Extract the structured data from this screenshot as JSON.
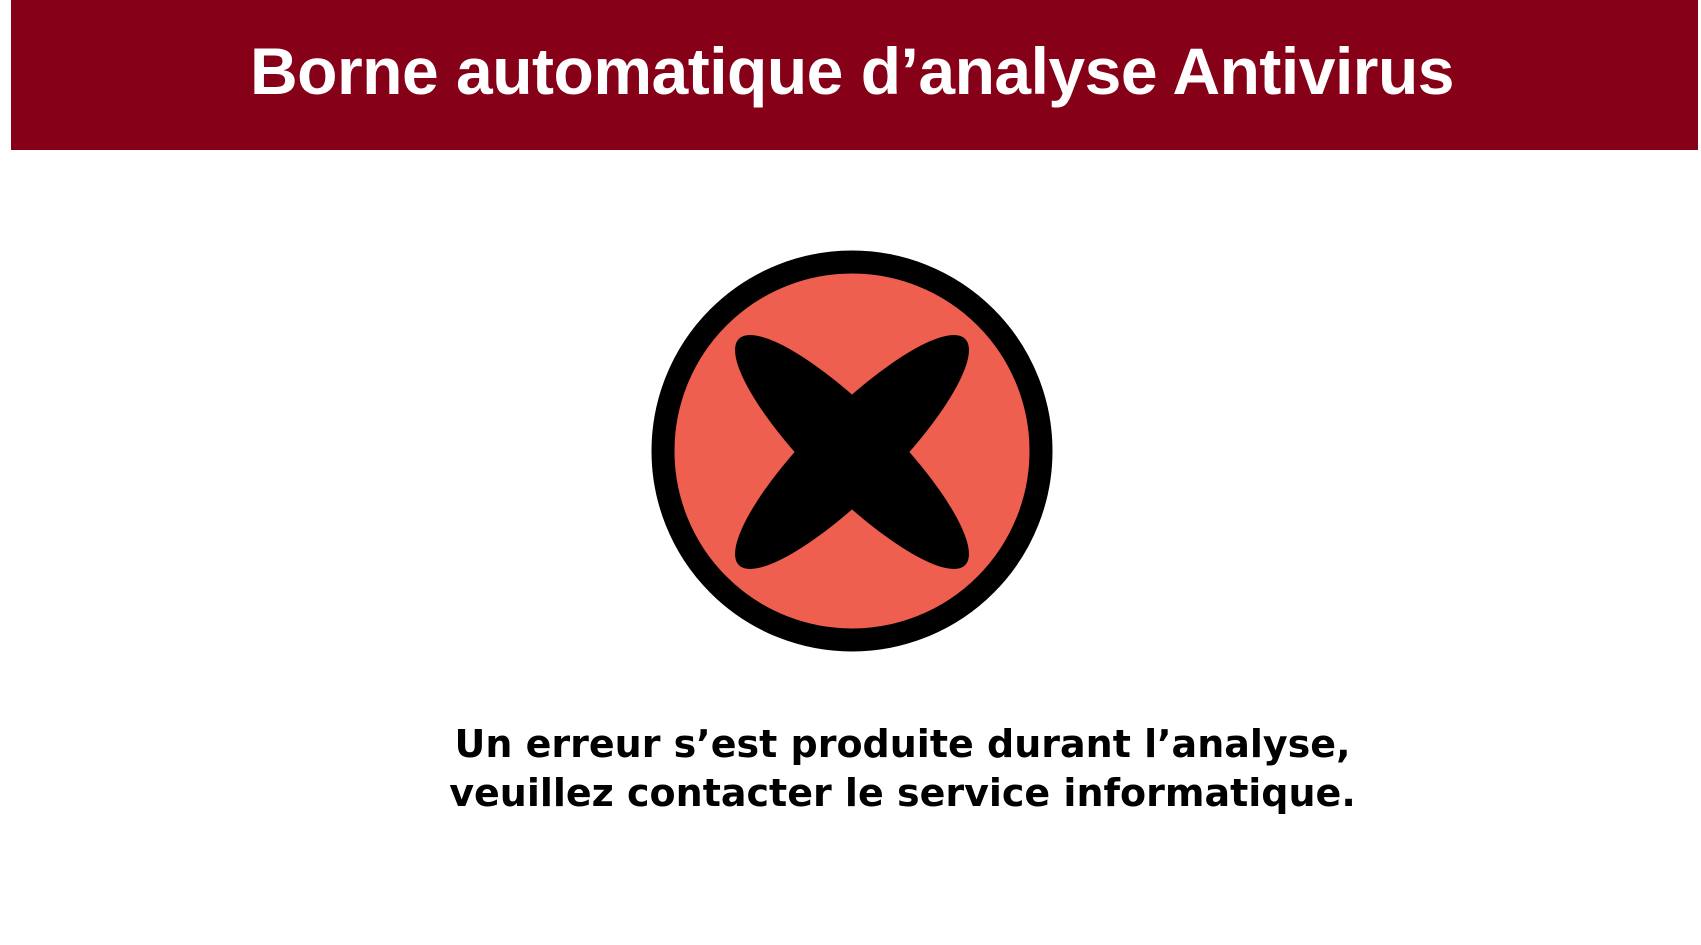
{
  "header": {
    "title": "Borne automatique d’analyse Antivirus"
  },
  "status": {
    "icon": "error-x-circle-icon",
    "message_line1": "Un erreur s’est produite durant l’analyse,",
    "message_line2": "veuillez contacter le service informatique."
  },
  "colors": {
    "header_background": "#860018",
    "header_text": "#ffffff",
    "icon_fill": "#ee5f4f",
    "icon_outline": "#000000",
    "message_text": "#000000"
  }
}
